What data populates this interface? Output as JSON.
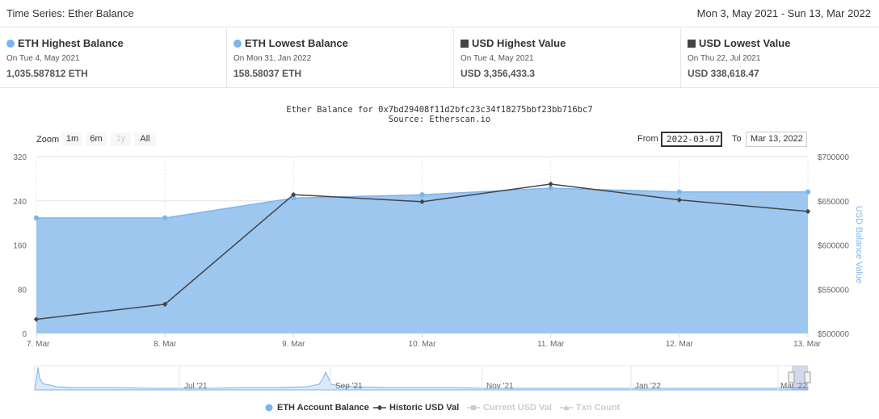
{
  "header": {
    "title": "Time Series: Ether Balance",
    "range": "Mon 3, May 2021 - Sun 13, Mar 2022"
  },
  "stats": [
    {
      "label": "ETH Highest Balance",
      "marker": "circle",
      "date": "On Tue 4, May 2021",
      "value": "1,035.587812 ETH"
    },
    {
      "label": "ETH Lowest Balance",
      "marker": "circle",
      "date": "On Mon 31, Jan 2022",
      "value": "158.58037 ETH"
    },
    {
      "label": "USD Highest Value",
      "marker": "square",
      "date": "On Tue 4, May 2021",
      "value": "USD 3,356,433.3"
    },
    {
      "label": "USD Lowest Value",
      "marker": "square",
      "date": "On Thu 22, Jul 2021",
      "value": "USD 338,618.47"
    }
  ],
  "colors": {
    "eth_area": "#9ec7f0",
    "eth_line": "#7cb5ec",
    "usd_line": "#434348",
    "grid": "#e6e6e6",
    "hidden": "#cccccc"
  },
  "zoom": {
    "label": "Zoom",
    "buttons": [
      {
        "label": "1m",
        "enabled": true
      },
      {
        "label": "6m",
        "enabled": true
      },
      {
        "label": "1y",
        "enabled": false
      },
      {
        "label": "All",
        "enabled": true
      }
    ]
  },
  "range_selector": {
    "from_label": "From",
    "from_value": "2022-03-07",
    "to_label": "To",
    "to_value": "Mar 13, 2022"
  },
  "chart_data": {
    "type": "area",
    "title": "Ether Balance for 0x7bd29408f11d2bfc23c34f18275bbf23bb716bc7",
    "subtitle": "Source: Etherscan.io",
    "categories": [
      "7. Mar",
      "8. Mar",
      "9. Mar",
      "10. Mar",
      "11. Mar",
      "12. Mar",
      "13. Mar"
    ],
    "y_left": {
      "ticks": [
        "0",
        "80",
        "160",
        "240",
        "320"
      ],
      "range": [
        0,
        320
      ]
    },
    "y_right": {
      "label": "USD Balance Value",
      "ticks": [
        "$500000",
        "$550000",
        "$600000",
        "$650000",
        "$700000"
      ],
      "range": [
        500000,
        700000
      ]
    },
    "series": [
      {
        "name": "ETH Account Balance",
        "type": "area",
        "axis": "left",
        "values": [
          209,
          209,
          245,
          251,
          263,
          256,
          256
        ]
      },
      {
        "name": "Historic USD Val",
        "type": "line",
        "axis": "right",
        "values": [
          516000,
          533000,
          657000,
          649000,
          669000,
          651000,
          638000
        ]
      }
    ],
    "grid": true
  },
  "navigator": {
    "labels": [
      "Jul '21",
      "Sep '21",
      "Nov '21",
      "Jan '22",
      "Mar '22"
    ]
  },
  "legend": [
    {
      "name": "ETH Account Balance",
      "marker": "circle",
      "visible": true
    },
    {
      "name": "Historic USD Val",
      "marker": "line-diamond",
      "visible": true
    },
    {
      "name": "Current USD Val",
      "marker": "line-square",
      "visible": false
    },
    {
      "name": "Txn Count",
      "marker": "line-triangle",
      "visible": false
    }
  ]
}
